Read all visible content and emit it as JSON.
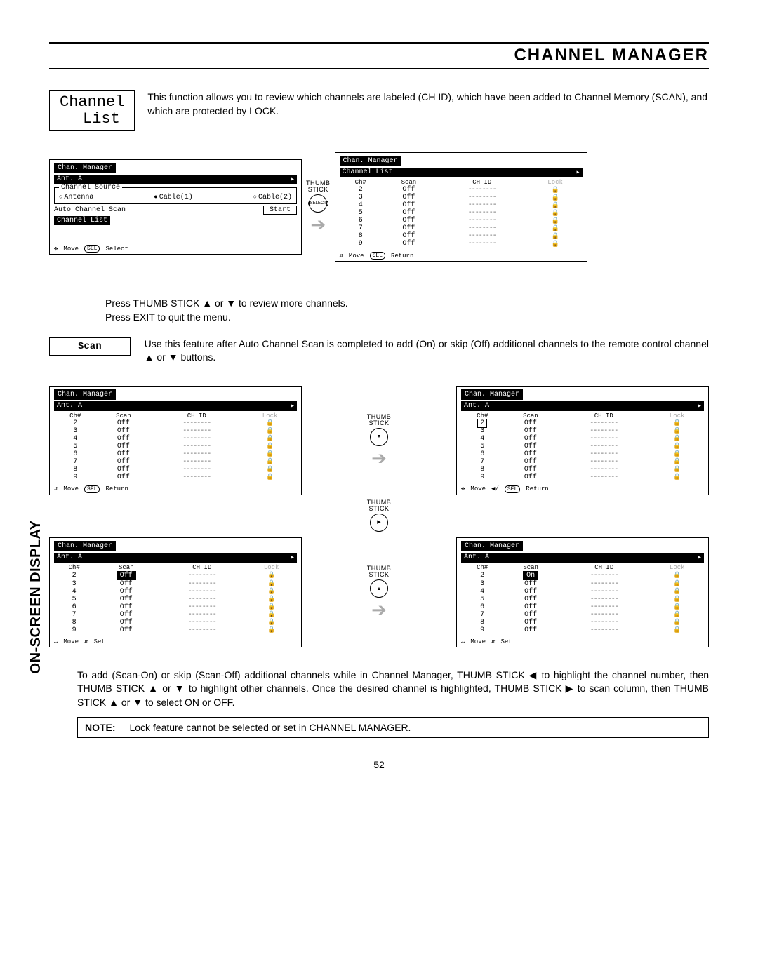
{
  "page_title": "CHANNEL MANAGER",
  "side_label": "ON-SCREEN DISPLAY",
  "page_number": "52",
  "channel_list_badge": "Channel\n  List",
  "intro_text": "This function allows you to review which channels are labeled (CH ID), which have been added to Channel Memory (SCAN), and which are protected by LOCK.",
  "press_text_1": "Press THUMB STICK ▲ or ▼ to review more channels.",
  "press_text_2": "Press EXIT to quit the menu.",
  "scan_badge": "Scan",
  "scan_text": "Use this feature after Auto Channel Scan is completed to add (On) or skip (Off) additional channels to the remote control channel ▲ or ▼ buttons.",
  "explain_text": "To add (Scan-On) or skip (Scan-Off) additional channels while in Channel Manager, THUMB STICK ◀ to highlight the channel number, then THUMB STICK ▲ or ▼ to highlight other channels.  Once the desired channel is highlighted, THUMB STICK ▶ to scan column, then THUMB STICK ▲ or ▼ to select ON or OFF.",
  "note_label": "NOTE:",
  "note_text": "Lock feature cannot be selected or set in CHANNEL MANAGER.",
  "panel_common": {
    "tab": "Chan. Manager",
    "sub": "Ant. A",
    "cols": {
      "ch": "Ch#",
      "scan": "Scan",
      "chid": "CH ID",
      "lock": "Lock"
    },
    "footer_move": "Move",
    "footer_sel": "SEL",
    "footer_select": "Select",
    "footer_return": "Return",
    "footer_set": "Set",
    "thumb": "THUMB\nSTICK",
    "select_inner": "SELECT"
  },
  "panel_A": {
    "title_fieldset": "Channel Source",
    "sources": [
      "Antenna",
      "Cable(1)",
      "Cable(2)"
    ],
    "selected_source": 1,
    "auto_scan_label": "Auto Channel Scan",
    "start": "Start",
    "channel_list": "Channel List"
  },
  "panel_B": {
    "highlight_sub": "Channel List",
    "rows": [
      {
        "ch": "2",
        "scan": "Off"
      },
      {
        "ch": "3",
        "scan": "Off"
      },
      {
        "ch": "4",
        "scan": "Off"
      },
      {
        "ch": "5",
        "scan": "Off"
      },
      {
        "ch": "6",
        "scan": "Off"
      },
      {
        "ch": "7",
        "scan": "Off"
      },
      {
        "ch": "8",
        "scan": "Off"
      },
      {
        "ch": "9",
        "scan": "Off"
      }
    ]
  },
  "grid_rows": [
    {
      "ch": "2",
      "scan": "Off"
    },
    {
      "ch": "3",
      "scan": "Off"
    },
    {
      "ch": "4",
      "scan": "Off"
    },
    {
      "ch": "5",
      "scan": "Off"
    },
    {
      "ch": "6",
      "scan": "Off"
    },
    {
      "ch": "7",
      "scan": "Off"
    },
    {
      "ch": "8",
      "scan": "Off"
    },
    {
      "ch": "9",
      "scan": "Off"
    }
  ],
  "grid_scan_states": {
    "panel1_highlight": null,
    "panel2_highlight_ch": "2",
    "panel3_highlight_scan_row": 0,
    "panel3_scan_value": "Off",
    "panel4_highlight_scan_row": 0,
    "panel4_scan_value": "On"
  }
}
